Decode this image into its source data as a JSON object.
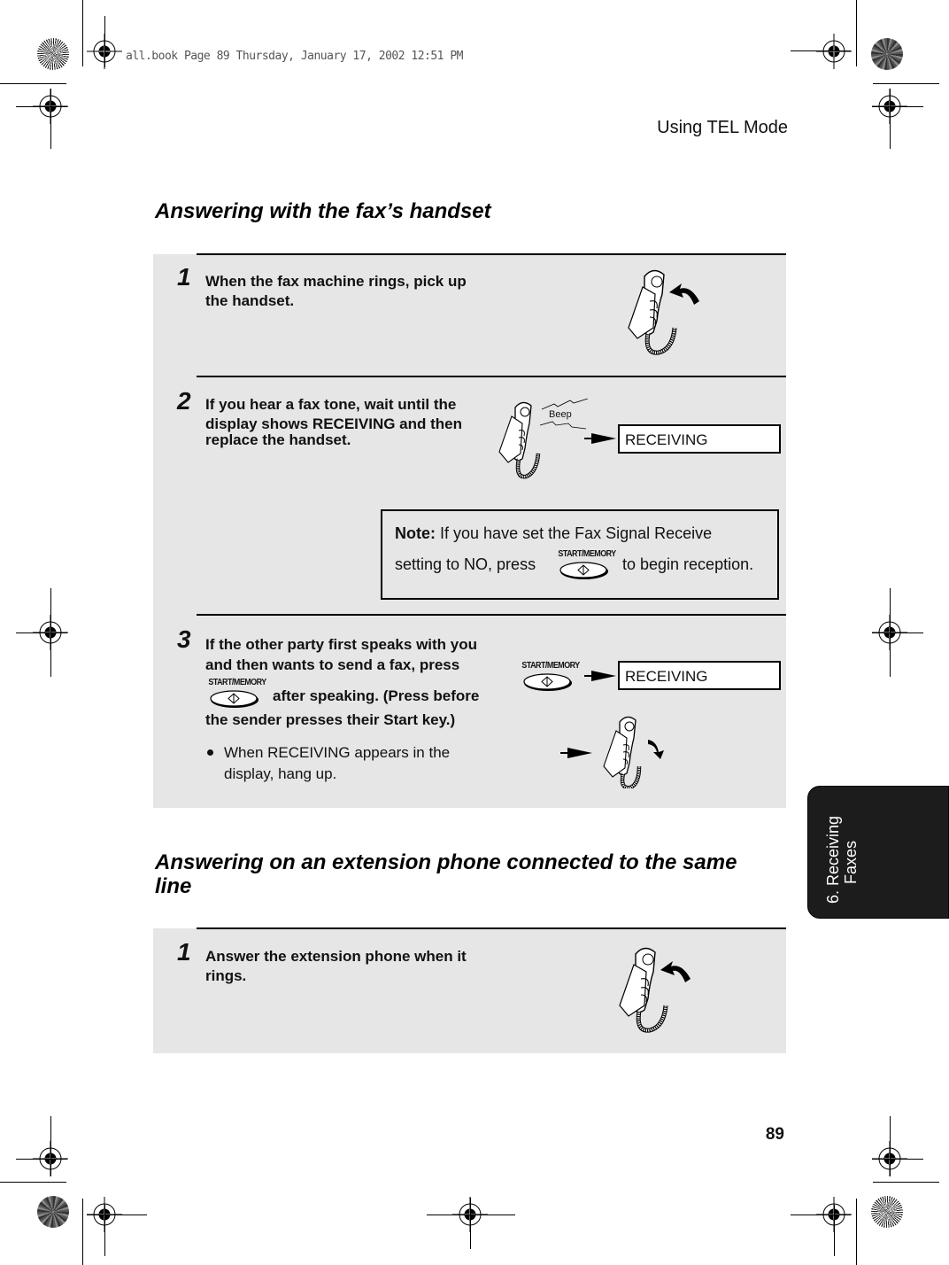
{
  "slug_line": "all.book  Page 89  Thursday, January 17, 2002  12:51 PM",
  "running_head": "Using TEL Mode",
  "page_number": "89",
  "chapter_tab": {
    "line1": "6. Receiving",
    "line2": "Faxes"
  },
  "section1": {
    "title": "Answering with the fax’s handset",
    "steps": [
      {
        "number": "1",
        "text_lines": [
          "When the fax machine rings, pick up",
          "the handset."
        ],
        "illustration": "handset-pickup-icon"
      },
      {
        "number": "2",
        "text_lines": [
          "If you hear a fax tone, wait until the",
          "display shows RECEIVING and then",
          "replace the handset."
        ],
        "illustration": "handset-beep-icon",
        "beep_label": "Beep",
        "display_text": "RECEIVING"
      },
      {
        "number": "3",
        "text_lines": [
          "If the other party first speaks with you",
          "and then wants to send a fax, press",
          "after speaking. (Press before",
          "the sender presses their Start key.)"
        ],
        "key_label": "START/MEMORY",
        "display_text": "RECEIVING",
        "bullet_lines": [
          "When RECEIVING appears in the",
          "display, hang up."
        ],
        "illustration": "handset-hangup-icon"
      }
    ],
    "note": {
      "label": "Note:",
      "line1": "If you have set the Fax Signal Receive",
      "line2_before": "setting to NO, press",
      "key_label": "START/MEMORY",
      "line2_after": "to begin reception."
    }
  },
  "section2": {
    "title_line1": "Answering on an extension phone connected to the same",
    "title_line2": "line",
    "steps": [
      {
        "number": "1",
        "text_lines": [
          "Answer the extension phone when it",
          "rings."
        ],
        "illustration": "handset-pickup-icon"
      }
    ]
  },
  "colors": {
    "panel_bg": "#e6e6e6",
    "tab_bg": "#1c1c1c",
    "text": "#111111"
  }
}
